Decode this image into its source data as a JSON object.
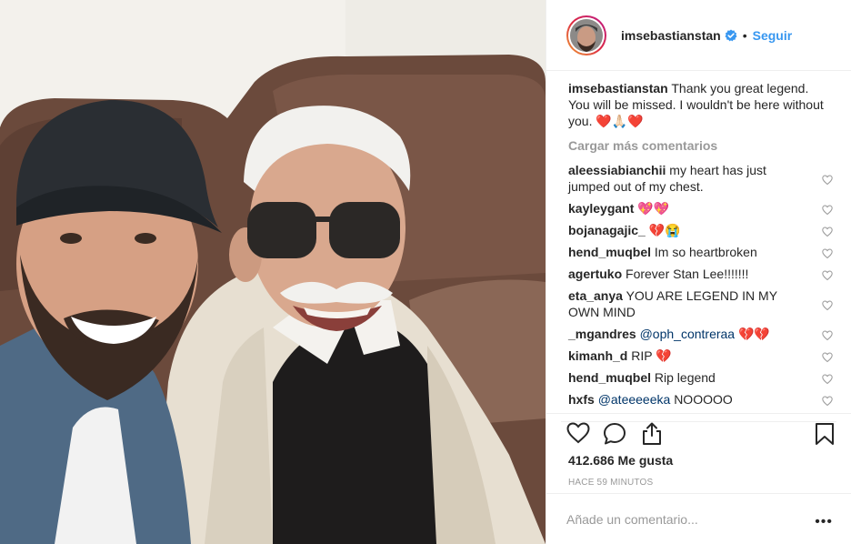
{
  "post": {
    "username": "imsebastianstan",
    "follow_label": "Seguir",
    "dot": "•",
    "caption": "Thank you great legend. You will be missed. I wouldn't be here without you. ❤️🙏🏻❤️",
    "load_more": "Cargar más comentarios",
    "likes": "412.686 Me gusta",
    "time": "HACE 59 MINUTOS",
    "add_comment_placeholder": "Añade un comentario...",
    "more_options": "•••"
  },
  "comments": [
    {
      "user": "aleessiabianchii",
      "text": "my heart has just jumped out of my chest."
    },
    {
      "user": "kayleygant",
      "text": "💖💖"
    },
    {
      "user": "bojanagajic_",
      "text": "💔😭"
    },
    {
      "user": "hend_muqbel",
      "text": "Im so heartbroken"
    },
    {
      "user": "agertuko",
      "text": "Forever Stan Lee!!!!!!!"
    },
    {
      "user": "eta_anya",
      "text": "YOU ARE LEGEND IN MY OWN MIND"
    },
    {
      "user": "_mgandres",
      "mention": "@oph_contreraa",
      "text": "💔💔"
    },
    {
      "user": "kimanh_d",
      "text": "RIP 💔"
    },
    {
      "user": "hend_muqbel",
      "text": "Rip legend"
    },
    {
      "user": "hxfs",
      "mention": "@ateeeeeka",
      "text": "NOOOOO"
    }
  ],
  "icons": {
    "verified": "verified-badge-icon",
    "like": "heart-icon",
    "comment": "comment-icon",
    "share": "share-icon",
    "save": "bookmark-icon"
  },
  "colors": {
    "link": "#3897f0",
    "muted": "#999999",
    "text": "#262626",
    "heart_red": "#ed4956"
  }
}
